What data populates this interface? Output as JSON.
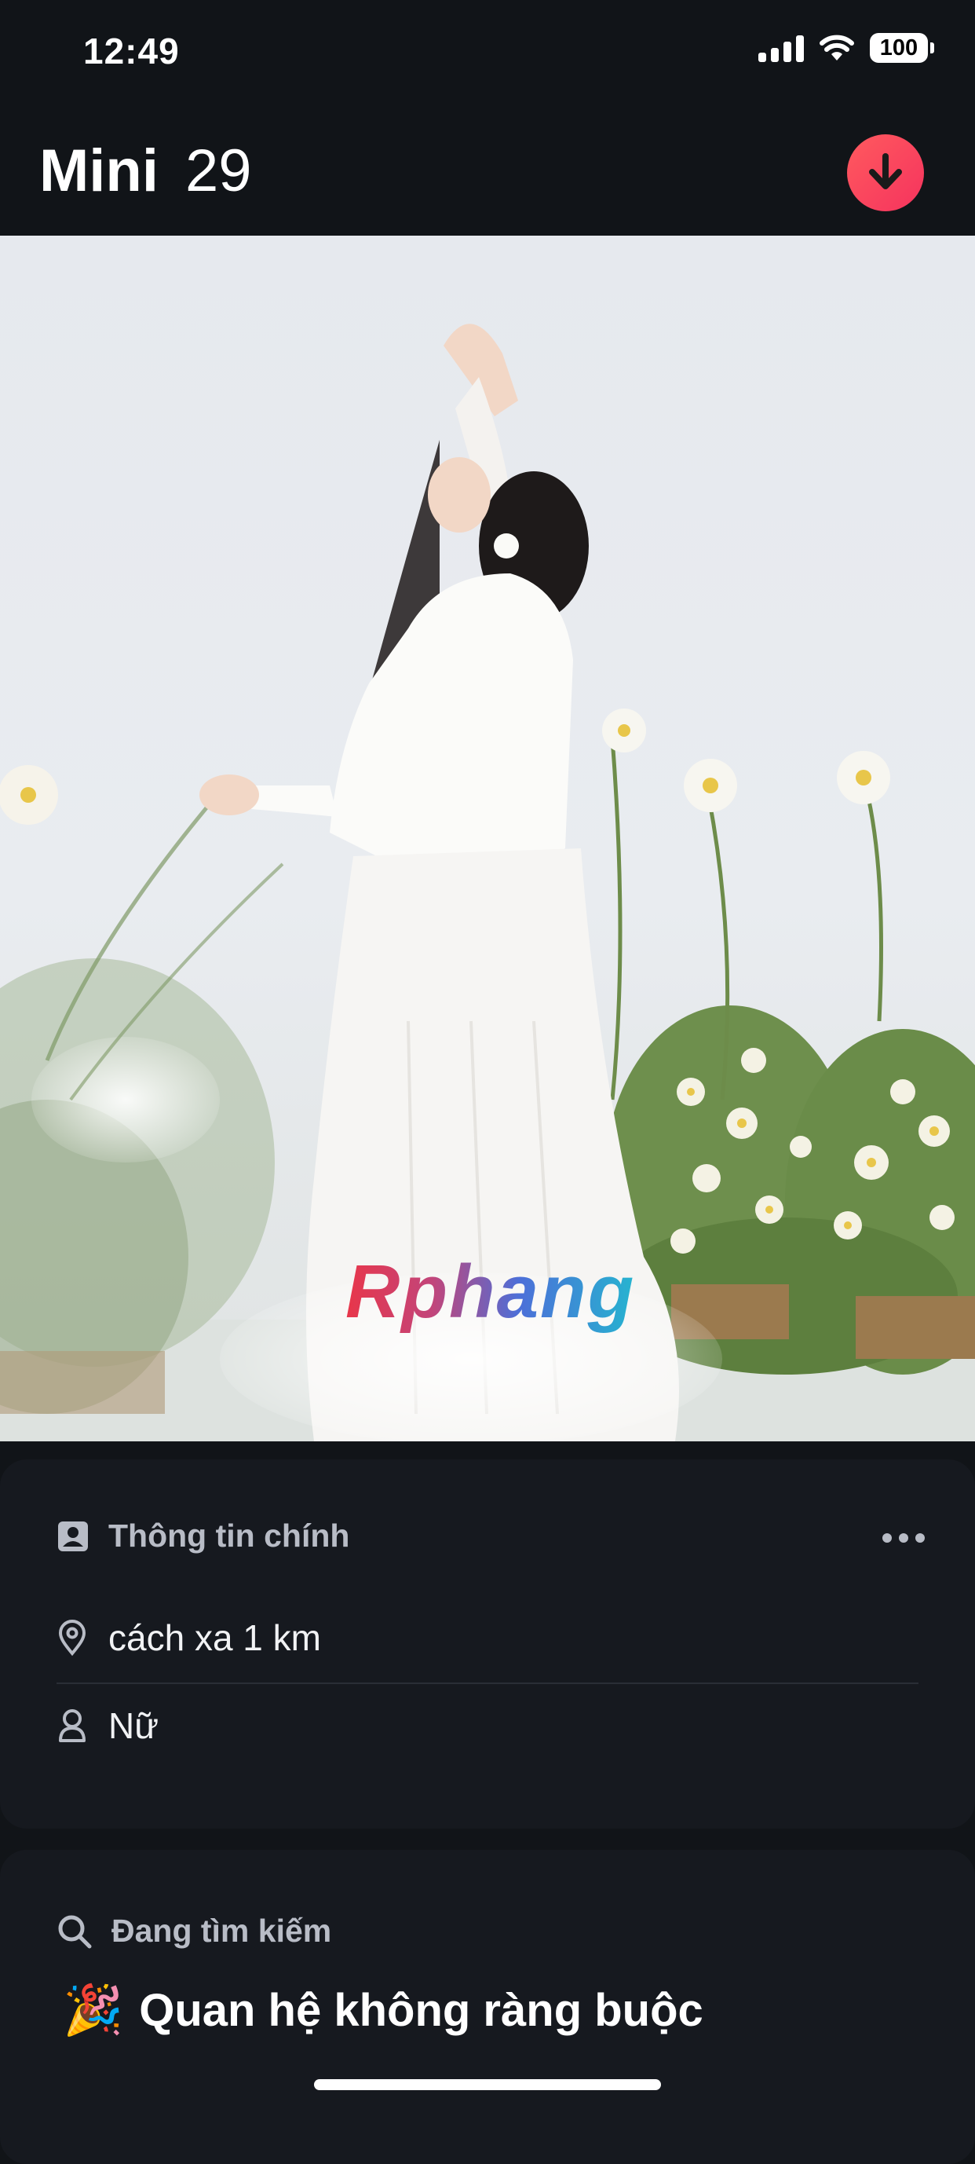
{
  "status_bar": {
    "time": "12:49",
    "battery": "100"
  },
  "header": {
    "name": "Mini",
    "age": "29"
  },
  "photo": {
    "watermark": "Rphang"
  },
  "main_info": {
    "title": "Thông tin chính",
    "distance": "cách xa 1 km",
    "gender": "Nữ"
  },
  "looking_for": {
    "title": "Đang tìm kiếm",
    "emoji": "🎉",
    "value": "Quan hệ không ràng buộc"
  },
  "colors": {
    "accent": "#f5335d",
    "background": "#111418",
    "card": "#16191f"
  },
  "icons": [
    "signal-icon",
    "wifi-icon",
    "battery-icon",
    "download-arrow-icon",
    "profile-card-icon",
    "more-dots-icon",
    "location-pin-icon",
    "person-icon",
    "search-icon"
  ]
}
